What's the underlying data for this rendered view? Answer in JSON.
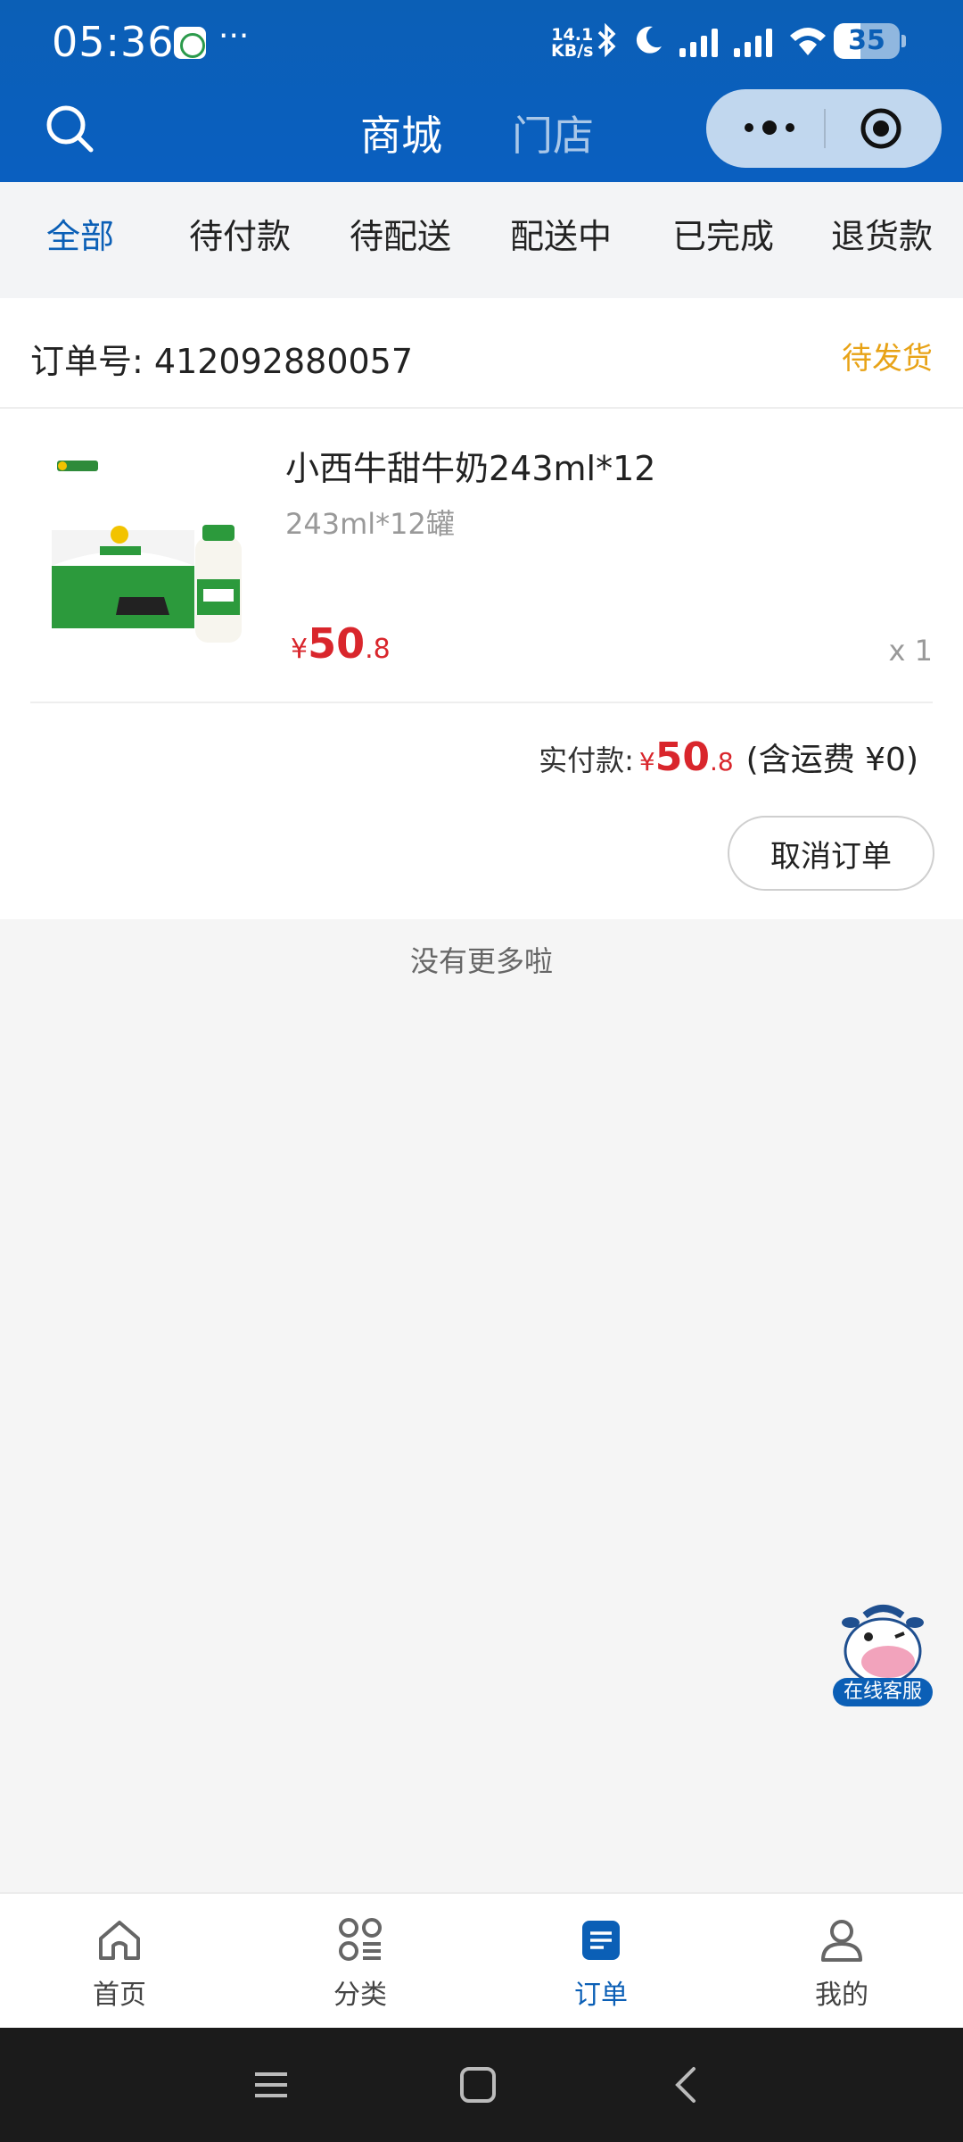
{
  "status_bar": {
    "time": "05:36",
    "more_dots": "···",
    "net_speed_top": "14.1",
    "net_speed_unit": "KB/s",
    "battery": "35"
  },
  "header": {
    "tabs": [
      {
        "label": "商城",
        "active": true
      },
      {
        "label": "门店",
        "active": false
      }
    ]
  },
  "filter_tabs": [
    {
      "label": "全部",
      "active": true
    },
    {
      "label": "待付款",
      "active": false
    },
    {
      "label": "待配送",
      "active": false
    },
    {
      "label": "配送中",
      "active": false
    },
    {
      "label": "已完成",
      "active": false
    },
    {
      "label": "退货款",
      "active": false
    }
  ],
  "order": {
    "order_no_label": "订单号:",
    "order_no": "412092880057",
    "status": "待发货",
    "product": {
      "name": "小西牛甜牛奶243ml*12",
      "spec": "243ml*12罐",
      "price_currency": "¥",
      "price_int": "50",
      "price_dec": ".8",
      "qty": "x 1"
    },
    "total": {
      "label": "实付款:",
      "currency": "¥",
      "int": "50",
      "dec": ".8",
      "shipping": "(含运费 ¥0)"
    },
    "cancel_label": "取消订单"
  },
  "list_end_text": "没有更多啦",
  "service_label": "在线客服",
  "bottom_nav": [
    {
      "label": "首页",
      "icon": "home-icon",
      "active": false
    },
    {
      "label": "分类",
      "icon": "category-icon",
      "active": false
    },
    {
      "label": "订单",
      "icon": "order-icon",
      "active": true
    },
    {
      "label": "我的",
      "icon": "user-icon",
      "active": false
    }
  ],
  "colors": {
    "brand_blue": "#0b5fb6",
    "price_red": "#d9262c",
    "status_orange": "#e8a317"
  }
}
